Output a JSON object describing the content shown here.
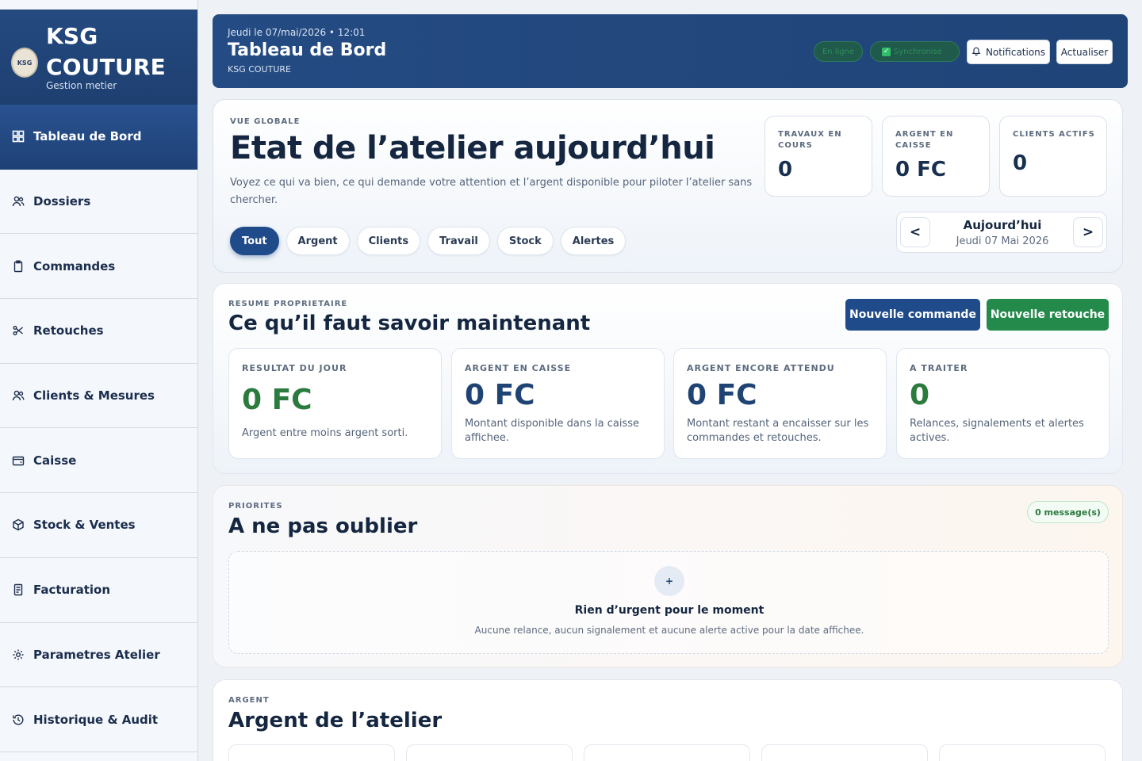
{
  "brand": {
    "name": "KSG COUTURE",
    "subtitle": "Gestion metier",
    "logo_text": "KSG"
  },
  "nav": [
    {
      "label": "Tableau de Bord",
      "icon": "dashboard-icon",
      "active": true
    },
    {
      "label": "Dossiers",
      "icon": "users-icon"
    },
    {
      "label": "Commandes",
      "icon": "clipboard-icon"
    },
    {
      "label": "Retouches",
      "icon": "scissors-icon"
    },
    {
      "label": "Clients & Mesures",
      "icon": "users-icon"
    },
    {
      "label": "Caisse",
      "icon": "wallet-icon"
    },
    {
      "label": "Stock & Ventes",
      "icon": "box-icon"
    },
    {
      "label": "Facturation",
      "icon": "invoice-icon"
    },
    {
      "label": "Parametres Atelier",
      "icon": "gear-icon"
    },
    {
      "label": "Historique & Audit",
      "icon": "history-icon"
    }
  ],
  "header": {
    "datetime": "Jeudi le 07/mai/2026 • 12:01",
    "title": "Tableau de Bord",
    "subtitle": "KSG COUTURE",
    "status_online": "En ligne",
    "status_sync": "Synchronisé",
    "notifications_label": "Notifications",
    "refresh_label": "Actualiser"
  },
  "overview": {
    "eyebrow": "VUE GLOBALE",
    "title": "Etat de l’atelier aujourd’hui",
    "description": "Voyez ce qui va bien, ce qui demande votre attention et l’argent disponible pour piloter l’atelier sans chercher.",
    "filters": [
      "Tout",
      "Argent",
      "Clients",
      "Travail",
      "Stock",
      "Alertes"
    ],
    "active_filter": "Tout",
    "kpis": [
      {
        "label": "TRAVAUX EN COURS",
        "value": "0"
      },
      {
        "label": "ARGENT EN CAISSE",
        "value": "0 FC"
      },
      {
        "label": "CLIENTS ACTIFS",
        "value": "0"
      }
    ],
    "date_nav": {
      "prev": "<",
      "next": ">",
      "label": "Aujourd’hui",
      "date": "Jeudi 07 Mai 2026"
    }
  },
  "resume": {
    "eyebrow": "RESUME PROPRIETAIRE",
    "title": "Ce qu’il faut savoir maintenant",
    "new_order_label": "Nouvelle commande",
    "new_alteration_label": "Nouvelle retouche",
    "stats": [
      {
        "label": "RESULTAT DU JOUR",
        "value": "0 FC",
        "description": "Argent entre moins argent sorti."
      },
      {
        "label": "ARGENT EN CAISSE",
        "value": "0 FC",
        "description": "Montant disponible dans la caisse affichee."
      },
      {
        "label": "ARGENT ENCORE ATTENDU",
        "value": "0 FC",
        "description": "Montant restant a encaisser sur les commandes et retouches."
      },
      {
        "label": "A TRAITER",
        "value": "0",
        "description": "Relances, signalements et alertes actives."
      }
    ]
  },
  "priorities": {
    "eyebrow": "PRIORITES",
    "title": "A ne pas oublier",
    "badge": "0 message(s)",
    "empty_icon": "+",
    "empty_title": "Rien d’urgent pour le moment",
    "empty_description": "Aucune relance, aucun signalement et aucune alerte active pour la date affichee."
  },
  "argent": {
    "eyebrow": "ARGENT",
    "title": "Argent de l’atelier"
  },
  "colors": {
    "brand_blue": "#1f4b8a",
    "success_green": "#248a4c",
    "sidebar_bg": "#f4f7fb"
  }
}
